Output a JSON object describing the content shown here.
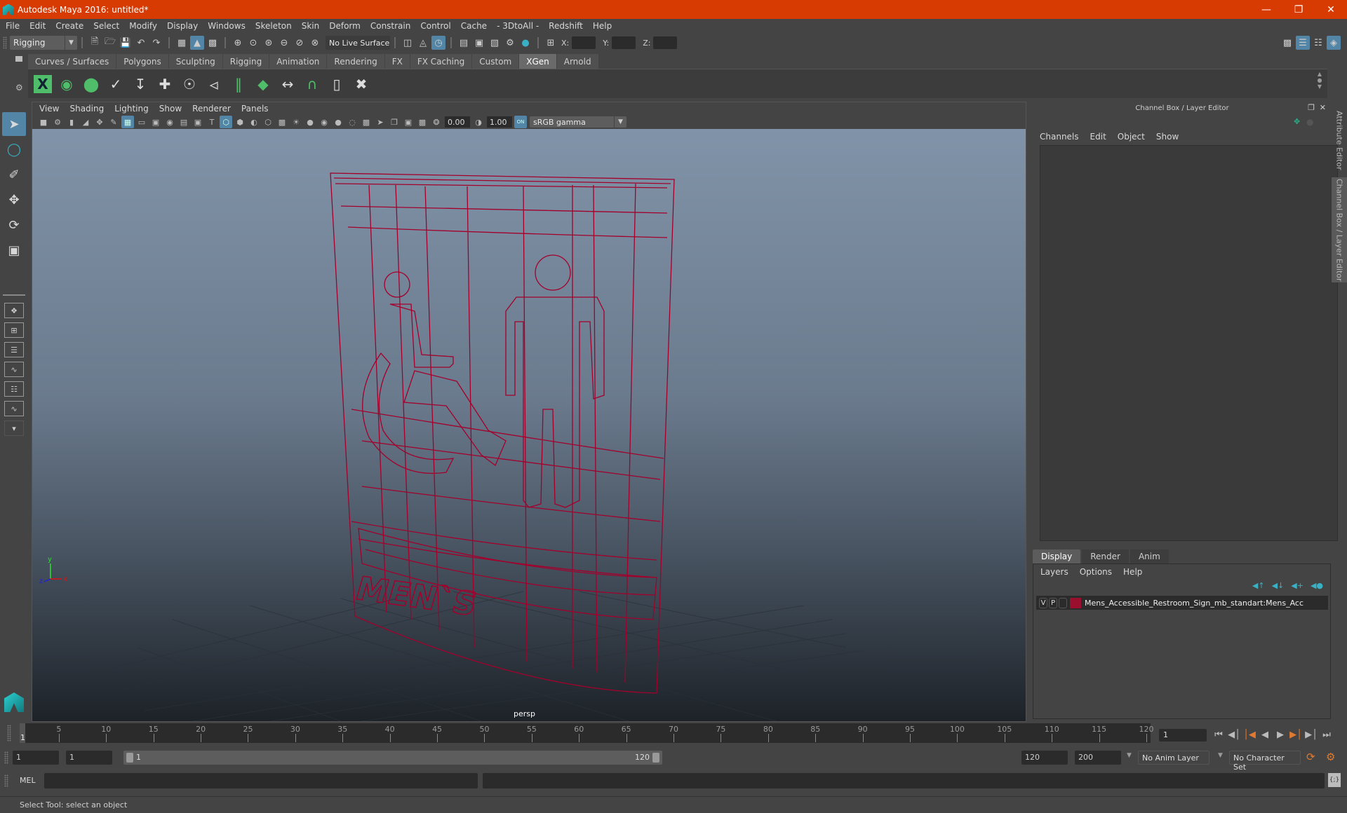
{
  "window": {
    "title": "Autodesk Maya 2016: untitled*",
    "controls": [
      "minimize",
      "restore",
      "close"
    ]
  },
  "menubar": [
    "File",
    "Edit",
    "Create",
    "Select",
    "Modify",
    "Display",
    "Windows",
    "Skeleton",
    "Skin",
    "Deform",
    "Constrain",
    "Control",
    "Cache",
    "- 3DtoAll -",
    "Redshift",
    "Help"
  ],
  "statusline": {
    "menuset": "Rigging",
    "live_surface": "No Live Surface",
    "x_label": "X:",
    "y_label": "Y:",
    "z_label": "Z:",
    "x_value": "",
    "y_value": "",
    "z_value": ""
  },
  "shelf": {
    "tabs": [
      "Curves / Surfaces",
      "Polygons",
      "Sculpting",
      "Rigging",
      "Animation",
      "Rendering",
      "FX",
      "FX Caching",
      "Custom",
      "XGen",
      "Arnold"
    ],
    "active_tab": "XGen",
    "icons": [
      "xgen-editor-icon",
      "preview-icon",
      "clear-preview-icon",
      "create-description-icon",
      "place-guides-icon",
      "add-guide-icon",
      "show-guide-icon",
      "lock-guide-icon",
      "sculpt-guides-icon",
      "density-icon",
      "guide-length-icon",
      "select-guides-icon",
      "region-icon",
      "delete-guides-icon"
    ]
  },
  "viewport": {
    "menu": [
      "View",
      "Shading",
      "Lighting",
      "Show",
      "Renderer",
      "Panels"
    ],
    "exposure": "0.00",
    "gamma": "1.00",
    "color_management": "ON",
    "colorspace": "sRGB gamma",
    "camera_label": "persp",
    "model_label": "MEN`S",
    "wire_color": "#a3002c",
    "axis": {
      "x": "x",
      "y": "y",
      "z": "z"
    }
  },
  "channelbox": {
    "title": "Channel Box / Layer Editor",
    "menu": [
      "Channels",
      "Edit",
      "Object",
      "Show"
    ]
  },
  "layereditor": {
    "tabs": [
      "Display",
      "Render",
      "Anim"
    ],
    "active_tab": "Display",
    "menu": [
      "Layers",
      "Options",
      "Help"
    ],
    "layers": [
      {
        "v": "V",
        "p": "P",
        "color": "#9b0f2e",
        "name": "Mens_Accessible_Restroom_Sign_mb_standart:Mens_Acc"
      }
    ]
  },
  "sidetabs": [
    "Attribute Editor",
    "Channel Box / Layer Editor"
  ],
  "timeslider": {
    "ticks": [
      5,
      10,
      15,
      20,
      25,
      30,
      35,
      40,
      45,
      50,
      55,
      60,
      65,
      70,
      75,
      80,
      85,
      90,
      95,
      100,
      105,
      110,
      115,
      120
    ],
    "min": 1,
    "max": 120,
    "current_frame": "1",
    "current_field": "1"
  },
  "range": {
    "start": "1",
    "start_playback": "1",
    "range_min_label": "1",
    "range_max_label": "120",
    "end_playback": "120",
    "end": "200",
    "anim_layer": "No Anim Layer",
    "character_set": "No Character Set"
  },
  "commandline": {
    "label": "MEL",
    "value": ""
  },
  "helpline": "Select Tool: select an object"
}
